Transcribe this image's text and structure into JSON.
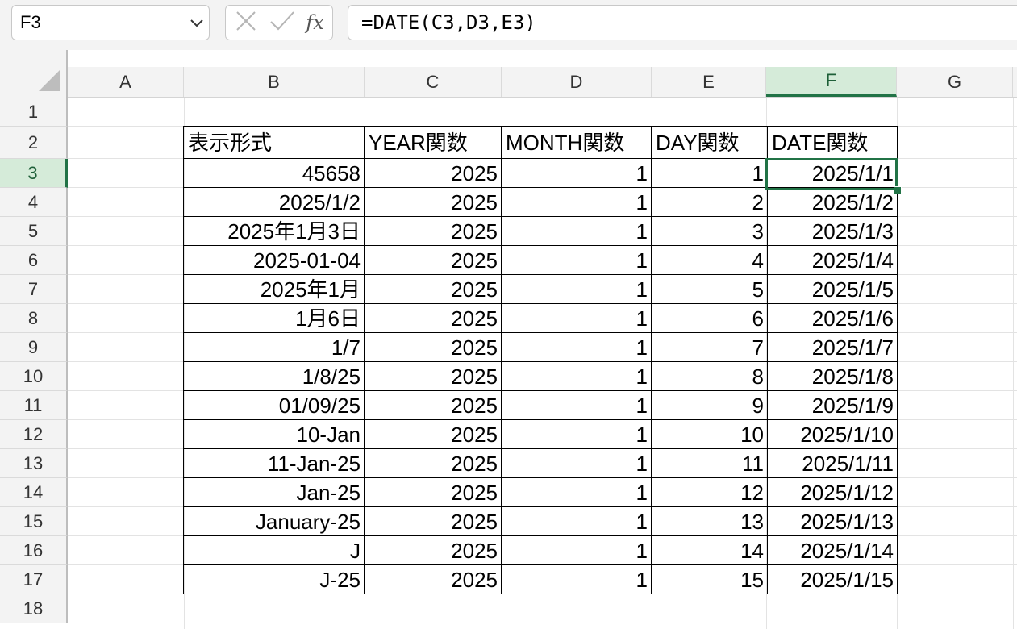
{
  "name_box": {
    "value": "F3"
  },
  "formula_bar": {
    "value": "=DATE(C3,D3,E3)",
    "fx_label": "fx"
  },
  "columns": [
    "A",
    "B",
    "C",
    "D",
    "E",
    "F",
    "G"
  ],
  "rows": [
    "1",
    "2",
    "3",
    "4",
    "5",
    "6",
    "7",
    "8",
    "9",
    "10",
    "11",
    "12",
    "13",
    "14",
    "15",
    "16",
    "17",
    "18"
  ],
  "selected": {
    "column": "F",
    "row": "3"
  },
  "table": {
    "headers": [
      "表示形式",
      "YEAR関数",
      "MONTH関数",
      "DAY関数",
      "DATE関数"
    ],
    "rows": [
      [
        "45658",
        "2025",
        "1",
        "1",
        "2025/1/1"
      ],
      [
        "2025/1/2",
        "2025",
        "1",
        "2",
        "2025/1/2"
      ],
      [
        "2025年1月3日",
        "2025",
        "1",
        "3",
        "2025/1/3"
      ],
      [
        "2025-01-04",
        "2025",
        "1",
        "4",
        "2025/1/4"
      ],
      [
        "2025年1月",
        "2025",
        "1",
        "5",
        "2025/1/5"
      ],
      [
        "1月6日",
        "2025",
        "1",
        "6",
        "2025/1/6"
      ],
      [
        "1/7",
        "2025",
        "1",
        "7",
        "2025/1/7"
      ],
      [
        "1/8/25",
        "2025",
        "1",
        "8",
        "2025/1/8"
      ],
      [
        "01/09/25",
        "2025",
        "1",
        "9",
        "2025/1/9"
      ],
      [
        "10-Jan",
        "2025",
        "1",
        "10",
        "2025/1/10"
      ],
      [
        "11-Jan-25",
        "2025",
        "1",
        "11",
        "2025/1/11"
      ],
      [
        "Jan-25",
        "2025",
        "1",
        "12",
        "2025/1/12"
      ],
      [
        "January-25",
        "2025",
        "1",
        "13",
        "2025/1/13"
      ],
      [
        "J",
        "2025",
        "1",
        "14",
        "2025/1/14"
      ],
      [
        "J-25",
        "2025",
        "1",
        "15",
        "2025/1/15"
      ]
    ]
  },
  "colors": {
    "accent": "#217346",
    "header_bg": "#f3f3f3",
    "selected_header_bg": "#d5ebd9"
  }
}
